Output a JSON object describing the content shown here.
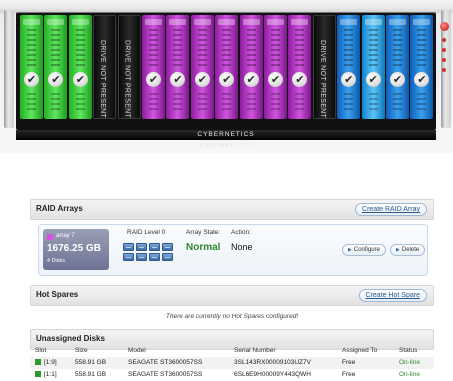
{
  "server": {
    "brand": "CYBERNETICS",
    "bays": [
      {
        "color": "green"
      },
      {
        "color": "green"
      },
      {
        "color": "green"
      },
      {
        "color": "empty",
        "label": "DRIVE NOT PRESENT"
      },
      {
        "color": "empty",
        "label": "DRIVE NOT PRESENT"
      },
      {
        "color": "purple"
      },
      {
        "color": "purple"
      },
      {
        "color": "purple"
      },
      {
        "color": "purple"
      },
      {
        "color": "purple"
      },
      {
        "color": "purple"
      },
      {
        "color": "purple"
      },
      {
        "color": "empty",
        "label": "DRIVE NOT PRESENT"
      },
      {
        "color": "blue"
      },
      {
        "color": "lightblue"
      },
      {
        "color": "blue"
      },
      {
        "color": "blue"
      }
    ]
  },
  "raid_arrays": {
    "title": "RAID Arrays",
    "create_button": "Create RAID Array",
    "array": {
      "name": "array 7",
      "size": "1676.25 GB",
      "disks": "4 Disks",
      "raid_level_label": "RAID Level 0",
      "state_label": "Array State:",
      "state_value": "Normal",
      "action_label": "Action:",
      "action_value": "None",
      "configure_button": "Configure",
      "delete_button": "Delete"
    }
  },
  "hot_spares": {
    "title": "Hot Spares",
    "create_button": "Create Hot Spare",
    "empty_message": "There are currently no Hot Spares configured!"
  },
  "unassigned_disks": {
    "title": "Unassigned Disks",
    "columns": [
      "Slot",
      "Size",
      "Model",
      "Serial Number",
      "Assigned To",
      "Status"
    ],
    "rows": [
      {
        "slot": "[1:9]",
        "size": "558.91 GB",
        "model": "SEAGATE ST3600057SS",
        "serial": "3SL143RX00009103UZ7V",
        "assigned": "Free",
        "status": "On-line"
      },
      {
        "slot": "[1:1]",
        "size": "558.91 GB",
        "model": "SEAGATE ST3600057SS",
        "serial": "6SL6E9H00009Y443QWH",
        "assigned": "Free",
        "status": "On-line"
      }
    ]
  },
  "colors": {
    "green_drive": "#3fcf3f",
    "purple_drive": "#b43ec6",
    "blue_drive": "#1f7fd6",
    "normal_state": "#2f8a2f",
    "link_blue": "#2c5a8c"
  }
}
